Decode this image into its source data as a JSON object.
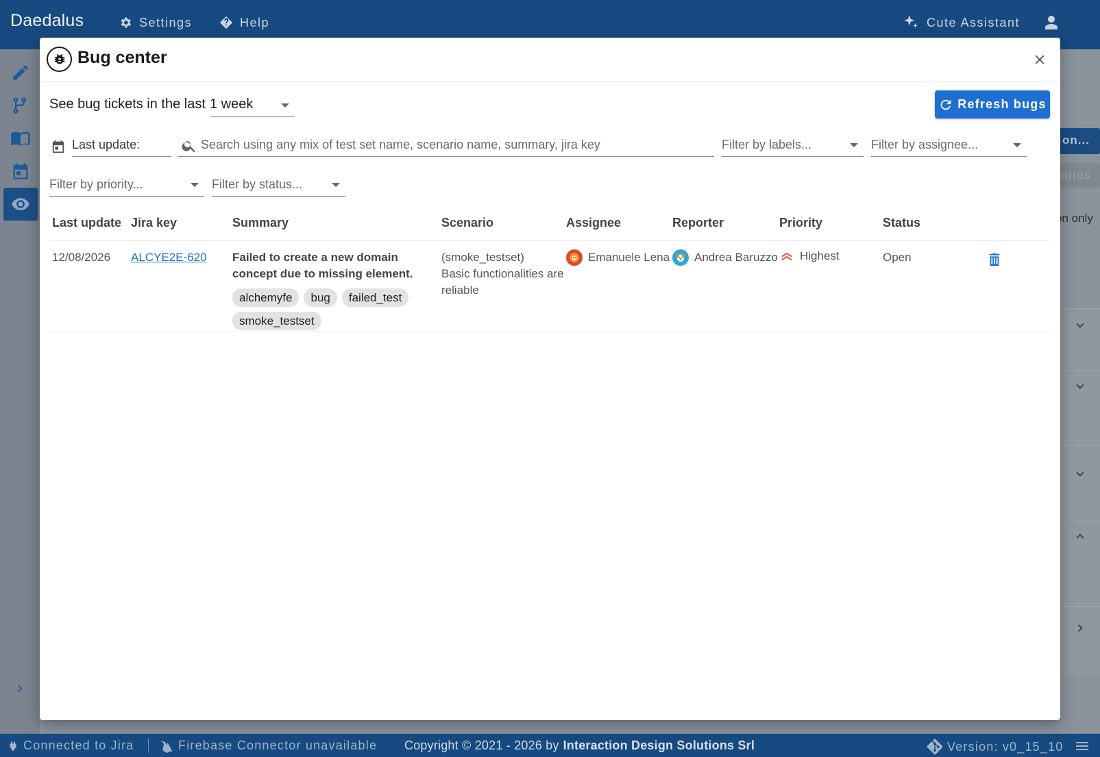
{
  "app": {
    "title": "Daedalus",
    "nav": {
      "settings": "Settings",
      "help": "Help",
      "assistant": "Cute Assistant"
    }
  },
  "background": {
    "blue_button": "on...",
    "gray_button": "arios",
    "partial_text": "on only"
  },
  "modal": {
    "title": "Bug center",
    "period_label": "See bug tickets in the last",
    "period_value": "1 week",
    "refresh_label": "Refresh bugs",
    "filters": {
      "last_update": "Last update:",
      "search_placeholder": "Search using any mix of test set name, scenario name, summary, jira key",
      "labels": "Filter by labels...",
      "assignee": "Filter by assignee...",
      "priority": "Filter by priority...",
      "status": "Filter by status..."
    },
    "columns": {
      "last_update": "Last update",
      "jira_key": "Jira key",
      "summary": "Summary",
      "scenario": "Scenario",
      "assignee": "Assignee",
      "reporter": "Reporter",
      "priority": "Priority",
      "status": "Status"
    },
    "rows": [
      {
        "last_update": "12/08/2026",
        "jira_key": "ALCYE2E-620",
        "summary": "Failed to create a new domain concept due to missing element.",
        "labels": [
          "alchemyfe",
          "bug",
          "failed_test",
          "smoke_testset"
        ],
        "scenario_set": "(smoke_testset)",
        "scenario_name": "Basic functionalities are reliable",
        "assignee": "Emanuele Lena",
        "reporter": "Andrea Baruzzo",
        "priority": "Highest",
        "status": "Open"
      }
    ]
  },
  "footer": {
    "jira": "Connected to Jira",
    "firebase": "Firebase Connector unavailable",
    "copyright_prefix": "Copyright © 2021 - 2026 by",
    "company": "Interaction Design Solutions Srl",
    "version": "Version: v0_15_10"
  },
  "colors": {
    "topbar": "#164a80",
    "primary": "#1e6fd1",
    "priority_highest": "#e8593b"
  }
}
